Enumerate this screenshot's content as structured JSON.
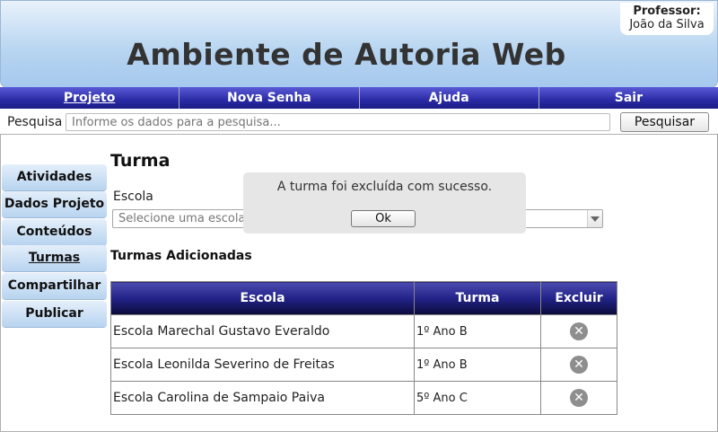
{
  "header": {
    "title": "Ambiente de Autoria Web",
    "professor_label": "Professor:",
    "professor_name": "João da Silva"
  },
  "nav": {
    "items": [
      {
        "label": "Projeto",
        "active": true
      },
      {
        "label": "Nova Senha",
        "active": false
      },
      {
        "label": "Ajuda",
        "active": false
      },
      {
        "label": "Sair",
        "active": false
      }
    ]
  },
  "search": {
    "label": "Pesquisa",
    "placeholder": "Informe os dados para a pesquisa...",
    "button": "Pesquisar"
  },
  "sidebar": {
    "items": [
      {
        "label": "Atividades",
        "active": false
      },
      {
        "label": "Dados Projeto",
        "active": false
      },
      {
        "label": "Conteúdos",
        "active": false
      },
      {
        "label": "Turmas",
        "active": true
      },
      {
        "label": "Compartilhar",
        "active": false
      },
      {
        "label": "Publicar",
        "active": false
      }
    ]
  },
  "main": {
    "title": "Turma",
    "escola_label": "Escola",
    "escola_placeholder": "Selecione uma escola",
    "section_title": "Turmas Adicionadas",
    "table": {
      "headers": [
        "Escola",
        "Turma",
        "Excluir"
      ],
      "rows": [
        [
          "Escola Marechal Gustavo Everaldo",
          "1º Ano B"
        ],
        [
          "Escola Leonilda Severino de Freitas",
          "1º Ano B"
        ],
        [
          "Escola Carolina de Sampaio Paiva",
          "5º Ano C"
        ]
      ]
    }
  },
  "modal": {
    "message": "A turma foi excluída com sucesso.",
    "ok_label": "Ok"
  },
  "colors": {
    "nav_bg": "#2b2ba6",
    "header_bg": "#b9d6f1",
    "sidebar_bg": "#b8d4f0",
    "table_header_bg": "#222288"
  },
  "icons": {
    "delete": "close-circle-icon"
  }
}
